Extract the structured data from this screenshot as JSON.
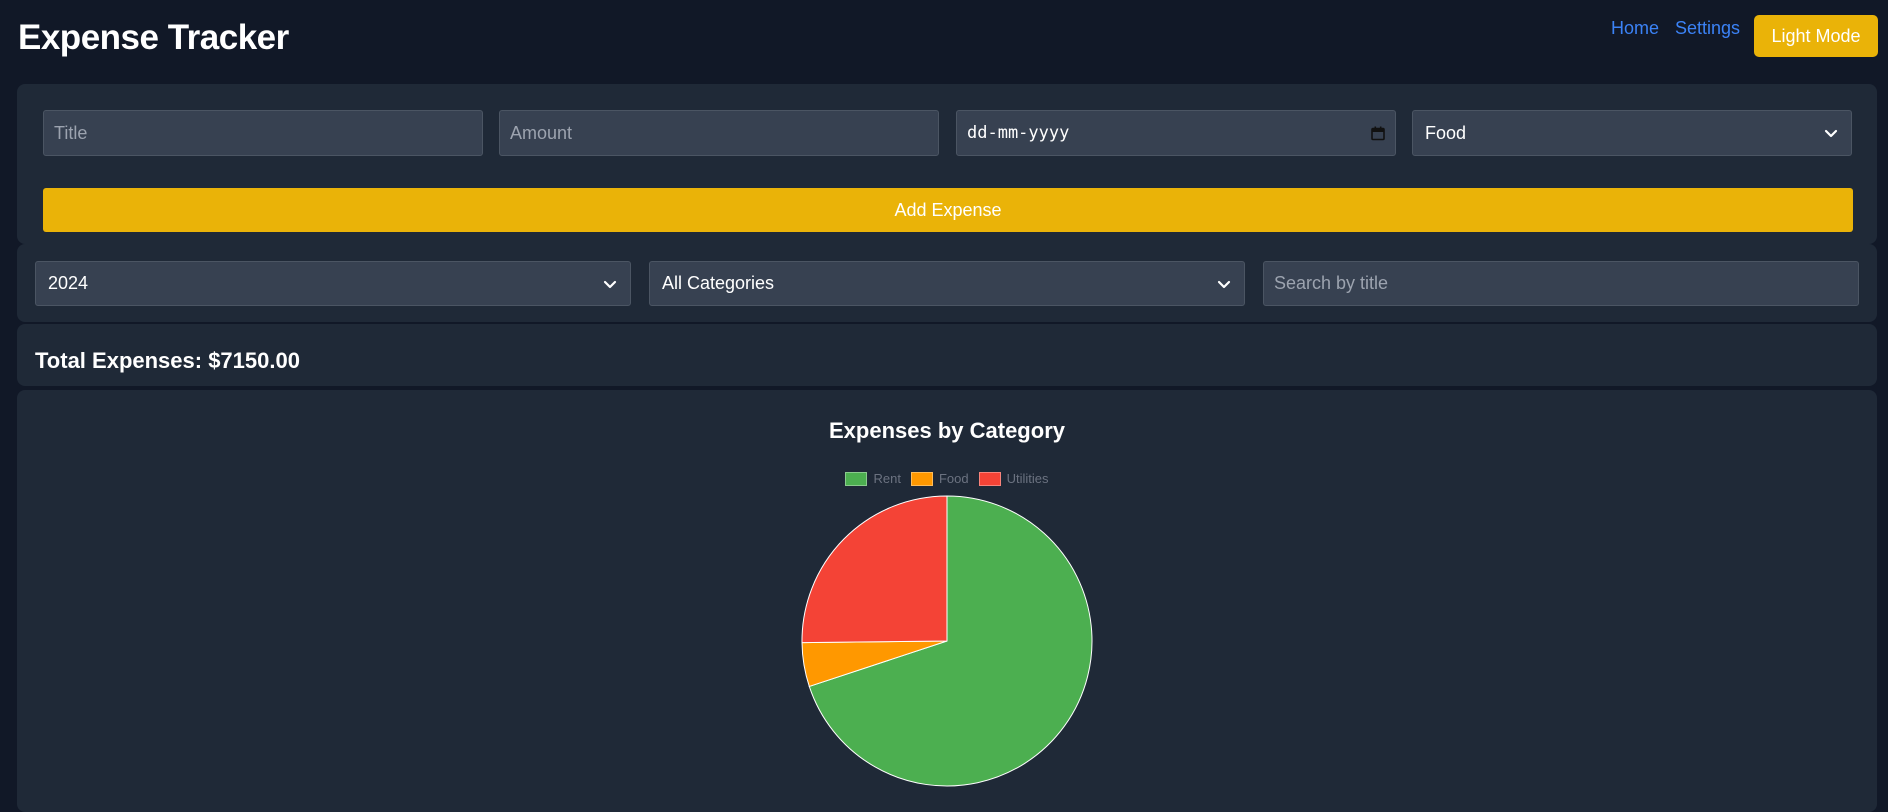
{
  "header": {
    "title": "Expense Tracker",
    "nav": {
      "home": "Home",
      "settings": "Settings"
    },
    "theme_toggle": "Light Mode"
  },
  "form": {
    "title_placeholder": "Title",
    "amount_placeholder": "Amount",
    "date_placeholder": "dd-mm-yyyy",
    "category_selected": "Food",
    "submit_label": "Add Expense"
  },
  "filters": {
    "year_selected": "2024",
    "category_selected": "All Categories",
    "search_placeholder": "Search by title"
  },
  "summary": {
    "total_label": "Total Expenses: $7150.00"
  },
  "colors": {
    "accent": "#eab308",
    "link": "#3b82f6",
    "rent": "#4caf50",
    "food": "#ff9800",
    "utilities": "#f44336"
  },
  "chart_data": {
    "type": "pie",
    "title": "Expenses by Category",
    "categories": [
      "Rent",
      "Food",
      "Utilities"
    ],
    "values": [
      5000,
      350,
      1800
    ],
    "colors": [
      "#4caf50",
      "#ff9800",
      "#f44336"
    ],
    "legend": "top"
  }
}
